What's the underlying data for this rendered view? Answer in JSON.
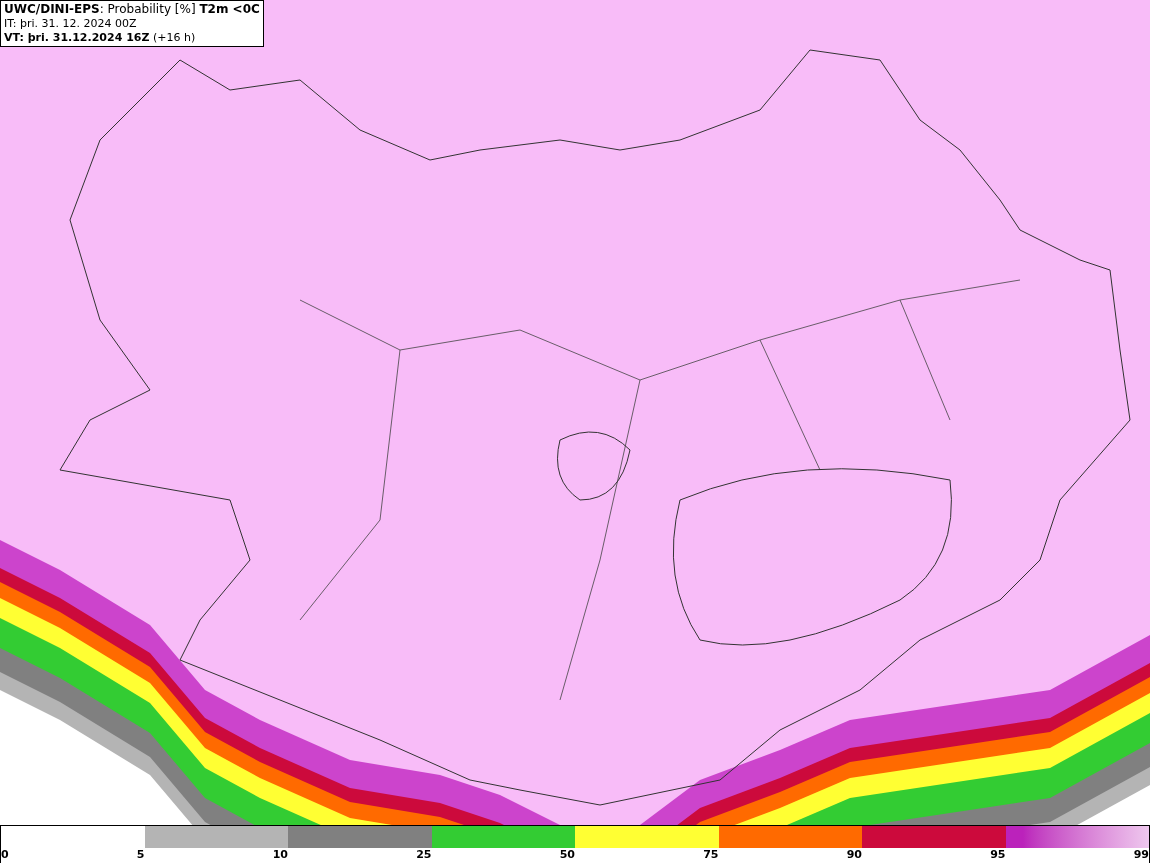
{
  "header": {
    "lines": [
      "**UWC/DINI-EPS**: Probability [%] **T2m <0C**",
      "IT: þri. 31. 12. 2024 00Z",
      "**VT: þri. 31.12.2024 16Z** (+16 h)"
    ]
  },
  "legend": {
    "segments": [
      {
        "kind": "solid",
        "color": "#b4b4b4"
      },
      {
        "kind": "solid",
        "color": "#808080"
      },
      {
        "kind": "solid",
        "color": "#33cc33"
      },
      {
        "kind": "solid",
        "color": "#ffff33"
      },
      {
        "kind": "solid",
        "color": "#ff6a00"
      },
      {
        "kind": "solid",
        "color": "#cc0a3c"
      },
      {
        "kind": "gradient",
        "color": "#bb22bb"
      }
    ],
    "labels": [
      "0",
      "5",
      "10",
      "25",
      "50",
      "75",
      "90",
      "95",
      "99"
    ]
  }
}
